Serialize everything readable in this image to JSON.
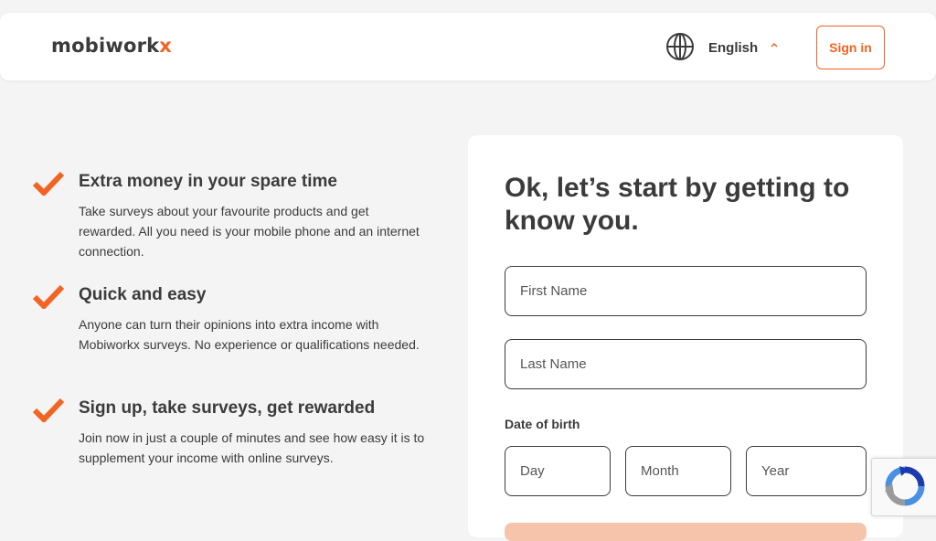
{
  "header": {
    "logo": {
      "text_main": "mobiwork",
      "text_accent": "x"
    },
    "language": {
      "label": "English",
      "icon": "globe-icon",
      "caret_icon": "chevron-up-icon"
    },
    "sign_in_label": "Sign in"
  },
  "features": [
    {
      "icon": "check-icon",
      "title": "Extra money in your spare time",
      "text": "Take surveys about your favourite products and get rewarded. All you need is your mobile phone and an internet connection."
    },
    {
      "icon": "check-icon",
      "title": "Quick and easy",
      "text": "Anyone can turn their opinions into extra income with Mobiworkx surveys. No experience or qualifications needed."
    },
    {
      "icon": "check-icon",
      "title": "Sign up, take surveys, get rewarded",
      "text": "Join now in just a couple of minutes and see how easy it is to supplement your income with online surveys."
    }
  ],
  "form": {
    "heading": "Ok, let’s start by getting to know you.",
    "first_name_placeholder": "First Name",
    "last_name_placeholder": "Last Name",
    "dob_label": "Date of birth",
    "day_placeholder": "Day",
    "month_placeholder": "Month",
    "year_placeholder": "Year"
  },
  "recaptcha": {
    "icon": "recaptcha-icon"
  },
  "colors": {
    "accent": "#f26422",
    "text": "#3b3b3b",
    "background": "#f4f4f4",
    "submit_disabled": "#f6c4ab"
  }
}
